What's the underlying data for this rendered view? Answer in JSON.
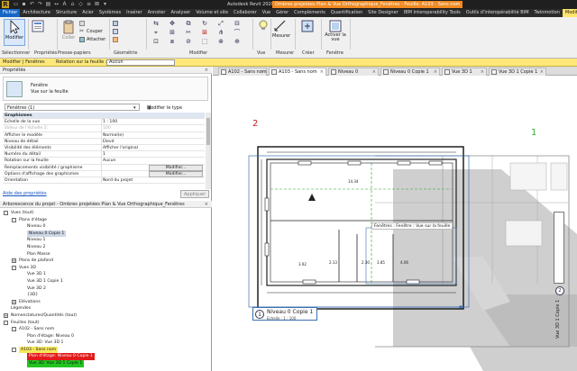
{
  "app": {
    "title": "Autodesk Revit 2020.2 -",
    "document_title": "Ombres projetées Plan & Vue Orthographique_Fenêtres - Feuille: A103 - Sans nom",
    "logo": "R"
  },
  "ribbon_tabs": [
    "Fichier",
    "Architecture",
    "Structure",
    "Acier",
    "Systèmes",
    "Insérer",
    "Annoter",
    "Analyser",
    "Volume et site",
    "Collaborer",
    "Vue",
    "Gérer",
    "Compléments",
    "Quantification",
    "Site Designer",
    "IBM Interoperability Tools",
    "Outils d'interopérabilité BIM",
    "Twinmotion",
    "Modif"
  ],
  "ribbon": {
    "modify_label": "Modifier",
    "paste_label": "Coller",
    "cut_label": "Couper",
    "join_label": "Attacher",
    "groups": [
      "Sélectionner",
      "Propriétés",
      "Presse-papiers",
      "Géométrie",
      "Modifier",
      "Vue",
      "Mesurer",
      "Créer",
      "Fenêtre"
    ],
    "activate_view_label": "Activer la vue"
  },
  "options_bar": {
    "context": "Modifier | Fenêtres",
    "rotation_label": "Rotation sur la feuille :",
    "rotation_value": "Aucun"
  },
  "properties": {
    "header": "Propriétés",
    "type_name": "Fenêtre",
    "type_sub": "Vue sur la feuille",
    "filter": "Fenêtres (1)",
    "modify_type": "Modifier le type",
    "rows": [
      {
        "k": "Graphismes",
        "v": "",
        "sec": true
      },
      {
        "k": "Echelle de la vue",
        "v": "1 : 100"
      },
      {
        "k": "Valeur de l'échelle    1:",
        "v": "100",
        "gray": true
      },
      {
        "k": "Afficher le modèle",
        "v": "Normal(e)"
      },
      {
        "k": "Niveau de détail",
        "v": "Elevé"
      },
      {
        "k": "Visibilité des éléments",
        "v": "Afficher l'original"
      },
      {
        "k": "Numéro du détail",
        "v": "1"
      },
      {
        "k": "Rotation sur la feuille",
        "v": "Aucun"
      },
      {
        "k": "Remplacements visibilité / graphisme",
        "v": "",
        "btn": "Modifier..."
      },
      {
        "k": "Options d'affichage des graphismes",
        "v": "",
        "btn": "Modifier..."
      },
      {
        "k": "Orientation",
        "v": "Nord du projet"
      }
    ],
    "help": "Aide des propriétés",
    "apply": "Appliquer"
  },
  "browser": {
    "header": "Arborescence du projet - Ombres projetées Plan & Vue Orthographique_Fenêtres",
    "items": [
      {
        "t": "Vues (tout)",
        "lvl": 0,
        "box": "-"
      },
      {
        "t": "Plans d'étage",
        "lvl": 1,
        "box": "-"
      },
      {
        "t": "Niveau 0",
        "lvl": 2
      },
      {
        "t": "Niveau 0 Copie 1",
        "lvl": 2,
        "hl": "sel"
      },
      {
        "t": "Niveau 1",
        "lvl": 2
      },
      {
        "t": "Niveau 2",
        "lvl": 2
      },
      {
        "t": "Plan Masse",
        "lvl": 2
      },
      {
        "t": "Plans de plafond",
        "lvl": 1,
        "box": "+"
      },
      {
        "t": "Vues 3D",
        "lvl": 1,
        "box": "-"
      },
      {
        "t": "Vue 3D 1",
        "lvl": 2
      },
      {
        "t": "Vue 3D 1 Copie 1",
        "lvl": 2
      },
      {
        "t": "Vue 3D 2",
        "lvl": 2
      },
      {
        "t": "{3D}",
        "lvl": 2
      },
      {
        "t": "Elévations",
        "lvl": 1,
        "box": "+"
      },
      {
        "t": "Légendes",
        "lvl": 0
      },
      {
        "t": "Nomenclatures/Quantités (tout)",
        "lvl": 0,
        "box": "+"
      },
      {
        "t": "Feuilles (tout)",
        "lvl": 0,
        "box": "-"
      },
      {
        "t": "A102 - Sans nom",
        "lvl": 1,
        "box": "-"
      },
      {
        "t": "Plan d'étage: Niveau 0",
        "lvl": 2
      },
      {
        "t": "Vue 3D: Vue 3D 1",
        "lvl": 2
      },
      {
        "t": "A103 - Sans nom",
        "lvl": 1,
        "box": "-",
        "hl": "yellow"
      },
      {
        "t": "Plan d'étage: Niveau 0 Copie 1",
        "lvl": 2,
        "hl": "red"
      },
      {
        "t": "Vue 3D: Vue 3D 1 Copie 1",
        "lvl": 2,
        "hl": "green"
      }
    ]
  },
  "view_tabs": [
    {
      "label": "A102 - Sans nom",
      "active": false
    },
    {
      "label": "A103 - Sans nom",
      "active": true
    },
    {
      "label": "Niveau 0",
      "active": false
    },
    {
      "label": "Niveau 0 Copie 1",
      "active": false
    },
    {
      "label": "Vue 3D 1",
      "active": false
    },
    {
      "label": "Vue 3D 1 Copie 1",
      "active": false
    }
  ],
  "canvas": {
    "marker_red": "2",
    "marker_green": "1",
    "viewport_label": "Fenêtres : Fenêtre : Vue sur la feuille",
    "viewport_title": "Niveau 0 Copie 1",
    "viewport_scale": "Echelle : 1 : 100",
    "viewport_number": "1",
    "side_title": "Vue 3D 1 Copie 1",
    "side_number": "2",
    "dims": [
      "14.34",
      "3.92",
      "2.30",
      "3.85",
      "4.06",
      "2.13"
    ]
  },
  "colors": {
    "accent_orange": "#f08a22",
    "file_tab": "#1666c5",
    "active_tab": "#ffe56b",
    "shadow_gray": "#c4c4c4",
    "marker_red": "#c81d1d",
    "marker_green": "#2fb02f"
  }
}
